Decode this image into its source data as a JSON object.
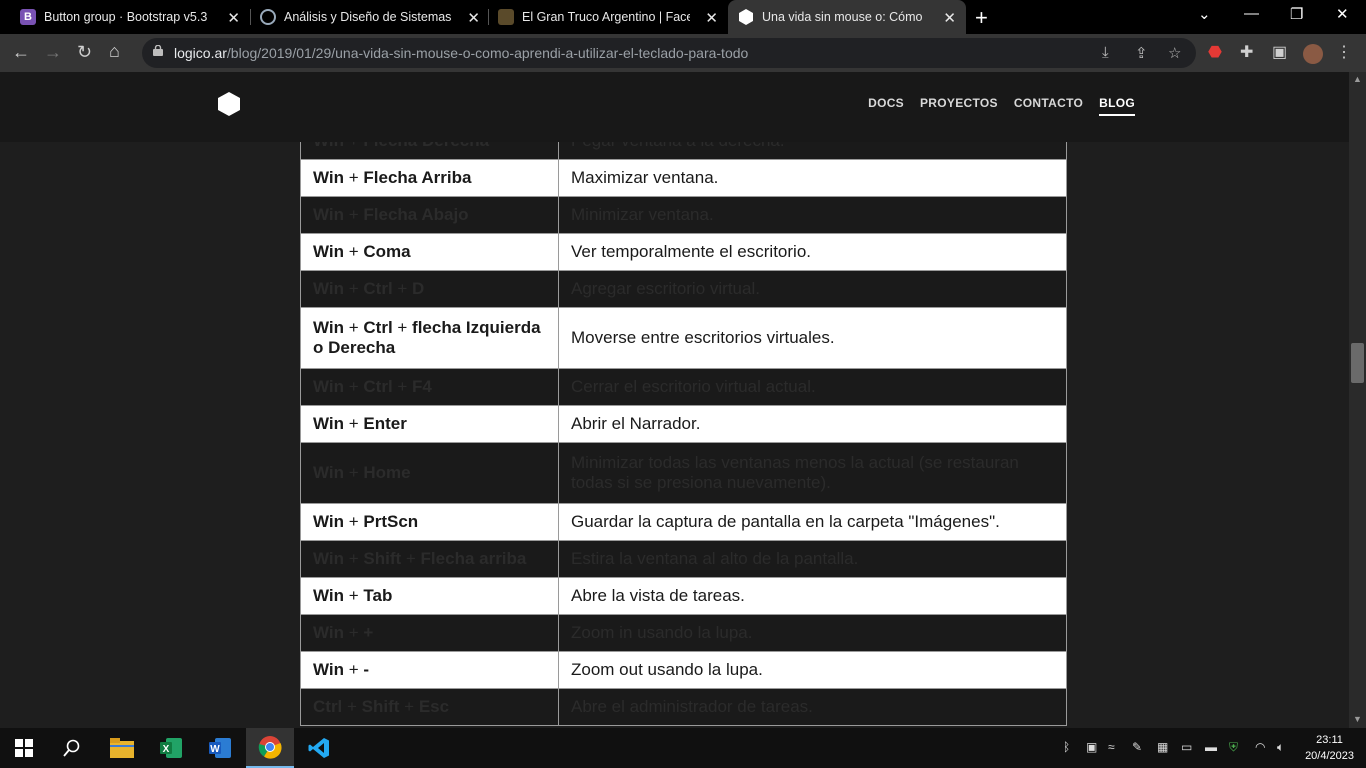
{
  "browser": {
    "tabs": [
      {
        "title": "Button group · Bootstrap v5.3",
        "favicon": "bootstrap-icon",
        "active": false
      },
      {
        "title": "Análisis y Diseño de Sistemas II -",
        "favicon": "university-icon",
        "active": false
      },
      {
        "title": "El Gran Truco Argentino | Facebo",
        "favicon": "facebook-group-icon",
        "active": false
      },
      {
        "title": "Una vida sin mouse o: Cómo apr",
        "favicon": "hexagon-icon",
        "active": true
      }
    ],
    "url_domain": "logico.ar",
    "url_path": "/blog/2019/01/29/una-vida-sin-mouse-o-como-aprendi-a-utilizar-el-teclado-para-todo"
  },
  "site": {
    "nav": [
      {
        "label": "DOCS",
        "active": false
      },
      {
        "label": "PROYECTOS",
        "active": false
      },
      {
        "label": "CONTACTO",
        "active": false
      },
      {
        "label": "BLOG",
        "active": true
      }
    ]
  },
  "shortcuts": [
    {
      "keys": [
        [
          "Win",
          true
        ],
        [
          " + ",
          false
        ],
        [
          "Flecha Derecha",
          true
        ]
      ],
      "desc": "Pegar ventana a la derecha.",
      "style": "dark"
    },
    {
      "keys": [
        [
          "Win",
          true
        ],
        [
          " + ",
          false
        ],
        [
          "Flecha Arriba",
          true
        ]
      ],
      "desc": "Maximizar ventana.",
      "style": "light"
    },
    {
      "keys": [
        [
          "Win",
          true
        ],
        [
          " + ",
          false
        ],
        [
          "Flecha Abajo",
          true
        ]
      ],
      "desc": "Minimizar ventana.",
      "style": "dark"
    },
    {
      "keys": [
        [
          "Win",
          true
        ],
        [
          " + ",
          false
        ],
        [
          "Coma",
          true
        ]
      ],
      "desc": "Ver temporalmente el escritorio.",
      "style": "light"
    },
    {
      "keys": [
        [
          "Win",
          true
        ],
        [
          " + ",
          false
        ],
        [
          "Ctrl",
          true
        ],
        [
          " + ",
          false
        ],
        [
          "D",
          true
        ]
      ],
      "desc": "Agregar escritorio virtual.",
      "style": "dark"
    },
    {
      "keys": [
        [
          "Win",
          true
        ],
        [
          " + ",
          false
        ],
        [
          "Ctrl",
          true
        ],
        [
          " + ",
          false
        ],
        [
          "flecha Izquierda o Derecha",
          true
        ]
      ],
      "desc": "Moverse entre escritorios virtuales.",
      "style": "light"
    },
    {
      "keys": [
        [
          "Win",
          true
        ],
        [
          " + ",
          false
        ],
        [
          "Ctrl",
          true
        ],
        [
          " + ",
          false
        ],
        [
          "F4",
          true
        ]
      ],
      "desc": "Cerrar el escritorio virtual actual.",
      "style": "dark"
    },
    {
      "keys": [
        [
          "Win",
          true
        ],
        [
          " + ",
          false
        ],
        [
          "Enter",
          true
        ]
      ],
      "desc": "Abrir el Narrador.",
      "style": "light"
    },
    {
      "keys": [
        [
          "Win",
          true
        ],
        [
          " + ",
          false
        ],
        [
          "Home",
          true
        ]
      ],
      "desc": "Minimizar todas las ventanas menos la actual (se restauran todas si se presiona nuevamente).",
      "style": "dark"
    },
    {
      "keys": [
        [
          "Win",
          true
        ],
        [
          " + ",
          false
        ],
        [
          "PrtScn",
          true
        ]
      ],
      "desc": "Guardar la captura de pantalla en la carpeta \"Imágenes\".",
      "style": "light"
    },
    {
      "keys": [
        [
          "Win",
          true
        ],
        [
          " + ",
          false
        ],
        [
          "Shift",
          true
        ],
        [
          " + ",
          false
        ],
        [
          "Flecha arriba",
          true
        ]
      ],
      "desc": "Estira la ventana al alto de la pantalla.",
      "style": "dark"
    },
    {
      "keys": [
        [
          "Win",
          true
        ],
        [
          " + ",
          false
        ],
        [
          "Tab",
          true
        ]
      ],
      "desc": "Abre la vista de tareas.",
      "style": "light"
    },
    {
      "keys": [
        [
          "Win",
          true
        ],
        [
          " + ",
          false
        ],
        [
          "+",
          true
        ]
      ],
      "desc": "Zoom in usando la lupa.",
      "style": "dark"
    },
    {
      "keys": [
        [
          "Win",
          true
        ],
        [
          " + ",
          false
        ],
        [
          "-",
          true
        ]
      ],
      "desc": "Zoom out usando la lupa.",
      "style": "light"
    },
    {
      "keys": [
        [
          "Ctrl",
          true
        ],
        [
          " + ",
          false
        ],
        [
          "Shift",
          true
        ],
        [
          " + ",
          false
        ],
        [
          "Esc",
          true
        ]
      ],
      "desc": "Abre el administrador de tareas.",
      "style": "dark"
    }
  ],
  "taskbar": {
    "apps": [
      "file-explorer-icon",
      "excel-icon",
      "word-icon",
      "chrome-icon",
      "vscode-icon"
    ],
    "time": "23:11",
    "date": "20/4/2023"
  }
}
